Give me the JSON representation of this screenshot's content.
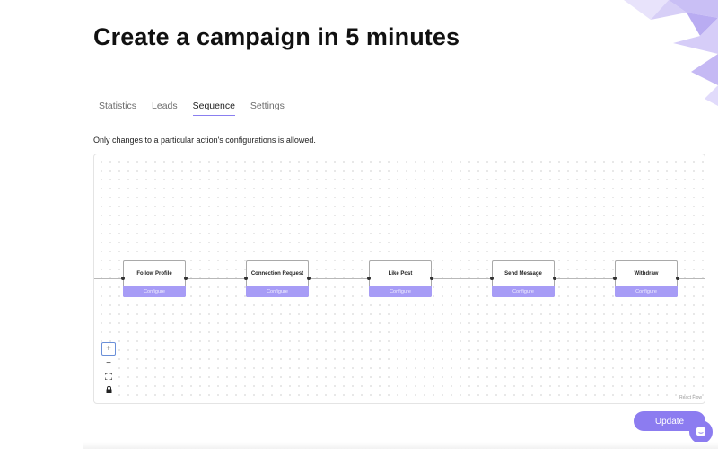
{
  "page": {
    "title": "Create a campaign in 5 minutes"
  },
  "tabs": [
    {
      "label": "Statistics",
      "active": false
    },
    {
      "label": "Leads",
      "active": false
    },
    {
      "label": "Sequence",
      "active": true
    },
    {
      "label": "Settings",
      "active": false
    }
  ],
  "notice": "Only changes to a particular action's configurations is allowed.",
  "flow": {
    "nodes": [
      {
        "title": "Follow Profile",
        "action": "Configure"
      },
      {
        "title": "Connection Request",
        "action": "Configure"
      },
      {
        "title": "Like Post",
        "action": "Configure"
      },
      {
        "title": "Send Message",
        "action": "Configure"
      },
      {
        "title": "Withdraw",
        "action": "Configure"
      }
    ],
    "controls": {
      "zoom_in": "+",
      "zoom_out": "−",
      "fit_view": "⛶",
      "lock": "🔒"
    },
    "attribution": "React Flow"
  },
  "actions": {
    "update_label": "Update"
  },
  "colors": {
    "accent": "#8c7cf0",
    "config_bar": "#a79cf6",
    "tab_underline": "#8a7ff0"
  },
  "icons": {
    "chat": "chat-icon",
    "decoration": "purple-shards"
  }
}
